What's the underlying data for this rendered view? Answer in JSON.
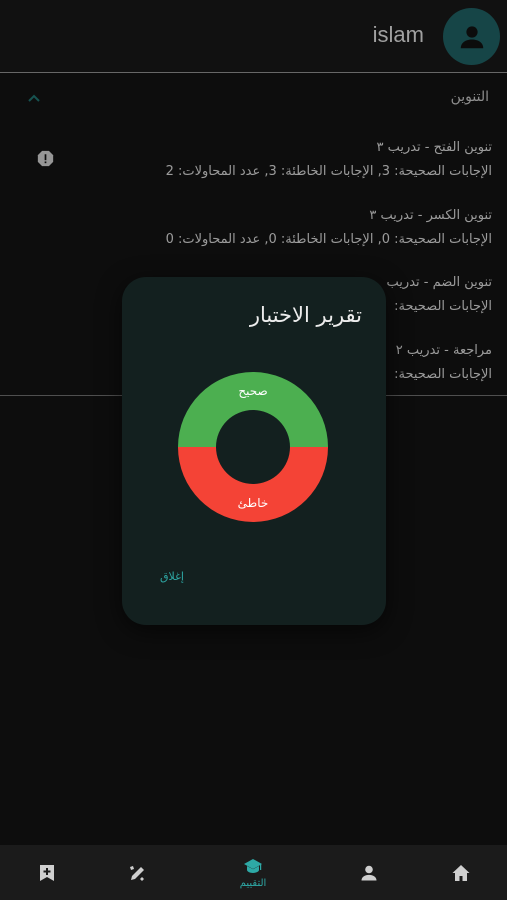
{
  "appbar": {
    "user_name": "islam",
    "avatar_icon": "person-icon"
  },
  "section": {
    "title": "التنوين",
    "items": [
      {
        "title": "تنوين الفتح - تدريب ٣",
        "stats": "الإجابات الصحيحة: 3, الإجابات الخاطئة: 3, عدد المحاولات: 2"
      },
      {
        "title": "تنوين الكسر - تدريب ٣",
        "stats": "الإجابات الصحيحة: 0, الإجابات الخاطئة: 0, عدد المحاولات: 0"
      },
      {
        "title": "تنوين الضم - تدريب",
        "stats": "الإجابات الصحيحة:"
      },
      {
        "title": "مراجعة - تدريب ٢",
        "stats": "الإجابات الصحيحة:"
      }
    ]
  },
  "dialog": {
    "title": "تقرير الاختبار",
    "close_label": "إغلاق",
    "chart_data": {
      "type": "pie",
      "categories": [
        "صحيح",
        "خاطئ"
      ],
      "values": [
        3,
        3
      ],
      "colors": [
        "#4caf50",
        "#f44336"
      ]
    }
  },
  "nav": {
    "items": [
      {
        "icon": "add-bookmark-icon",
        "label": ""
      },
      {
        "icon": "edit-icon",
        "label": ""
      },
      {
        "icon": "graduation-cap-icon",
        "label": "التقييم",
        "active": true
      },
      {
        "icon": "person-icon",
        "label": ""
      },
      {
        "icon": "home-icon",
        "label": ""
      }
    ]
  },
  "colors": {
    "accent": "#2ea9a6",
    "avatar_bg": "#1e5d5f",
    "dialog_bg": "#13201f"
  }
}
